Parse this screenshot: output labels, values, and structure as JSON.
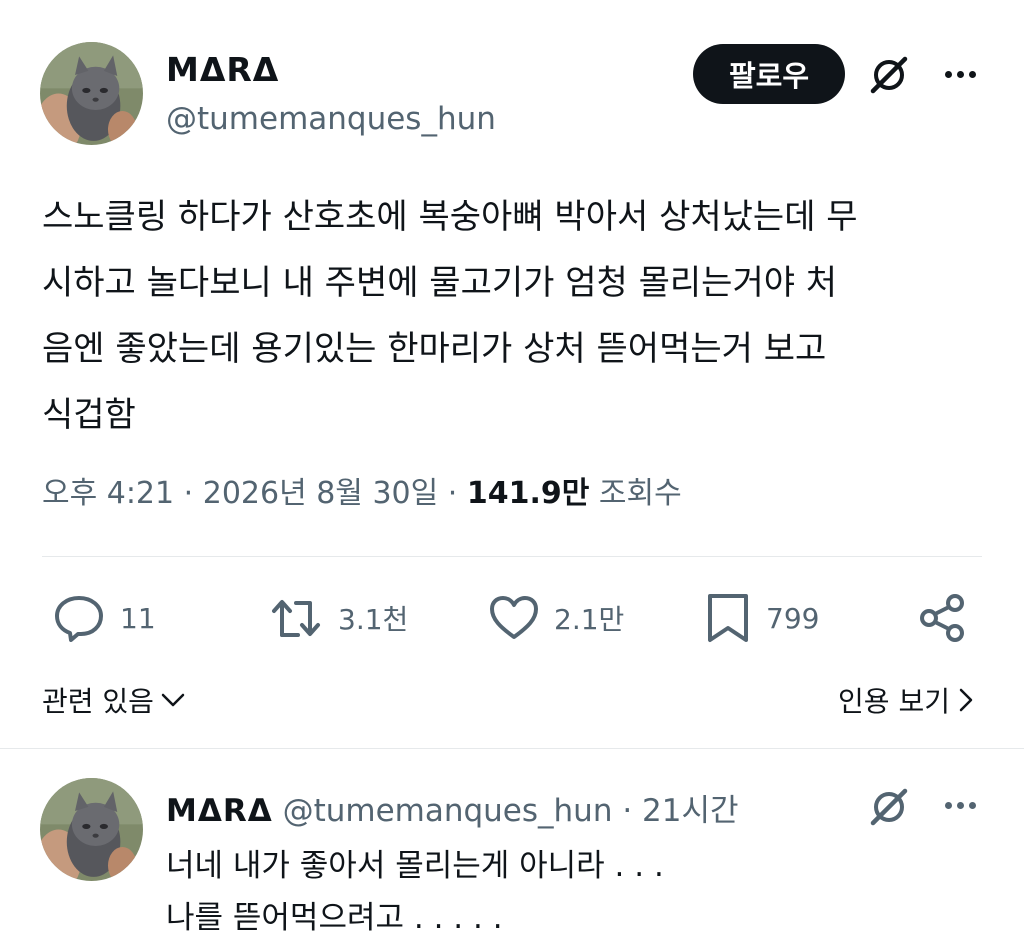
{
  "post": {
    "author_name": "MΔRΔ",
    "handle": "@tumemanques_hun",
    "follow_label": "팔로우",
    "text_lines": [
      "스노클링 하다가 산호초에 복숭아뼈 박아서 상처났는데 무",
      "시하고 놀다보니 내 주변에 물고기가 엄청 몰리는거야 처",
      "음엔 좋았는데 용기있는 한마리가 상처 뜯어먹는거 보고",
      "식겁함"
    ],
    "time": "오후 4:21",
    "date": "2026년 8월 30일",
    "views_count": "141.9만",
    "views_label": "조회수",
    "icons": {
      "grok": "grok-slash-icon",
      "more": "more-dots-icon"
    }
  },
  "actions": {
    "reply_count": "11",
    "repost_count": "3.1천",
    "like_count": "2.1만",
    "bookmark_count": "799",
    "icons": [
      "reply-icon",
      "repost-icon",
      "like-icon",
      "bookmark-icon",
      "share-icon"
    ]
  },
  "links": {
    "related": "관련 있음",
    "quotes": "인용 보기"
  },
  "reply": {
    "author_name": "MΔRΔ",
    "handle": "@tumemanques_hun",
    "separator": "·",
    "time_ago": "21시간",
    "text_lines": [
      "너네 내가 좋아서 몰리는게 아니라 . . .",
      "나를 뜯어먹으려고 . . . . ."
    ]
  },
  "colors": {
    "text": "#0f1419",
    "secondary": "#536471",
    "divider": "#e6e9eb",
    "button_bg": "#0f1419"
  }
}
